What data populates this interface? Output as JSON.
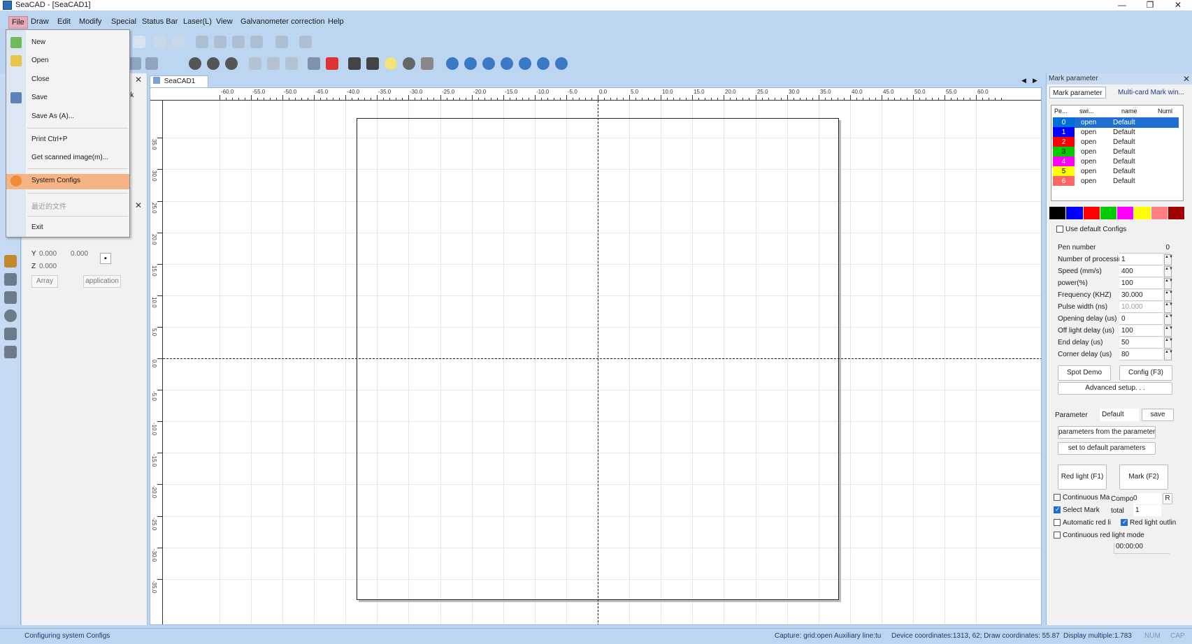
{
  "window": {
    "title": "SeaCAD - [SeaCAD1]",
    "min_glyph": "—",
    "max_glyph": "❐",
    "close_glyph": "✕"
  },
  "menubar": {
    "items": [
      "File",
      "Draw",
      "Edit",
      "Modify",
      "Special",
      "Status Bar",
      "Laser(L)",
      "View",
      "Galvanometer correction",
      "Help"
    ]
  },
  "file_menu": {
    "items": [
      {
        "label": "New",
        "icon": "new-icon"
      },
      {
        "label": "Open",
        "icon": "open-folder-icon"
      },
      {
        "label": "Close",
        "icon": ""
      },
      {
        "label": "Save",
        "icon": "save-icon"
      },
      {
        "label": "Save As (A)...",
        "icon": ""
      },
      {
        "label": "Print Ctrl+P",
        "icon": ""
      },
      {
        "label": "Get scanned image(m)...",
        "icon": ""
      },
      {
        "label": "System Configs",
        "icon": "gear-icon"
      },
      {
        "label": "最近的文件",
        "icon": ""
      },
      {
        "label": "Exit",
        "icon": ""
      }
    ],
    "highlighted": "System Configs"
  },
  "left_panel": {
    "partial_label": "rk",
    "y_label": "Y",
    "y_value": "0.000",
    "y_value2": "0.000",
    "z_label": "Z",
    "z_value": "0.000",
    "array_btn": "Array",
    "apply_btn": "application"
  },
  "document": {
    "tab_label": "SeaCAD1",
    "tab_close": "✕"
  },
  "ruler": {
    "h_labels": [
      "-60.0",
      "-55.0",
      "-50.0",
      "-45.0",
      "-40.0",
      "-35.0",
      "-30.0",
      "-25.0",
      "-20.0",
      "-15.0",
      "-10.0",
      "-5.0",
      "0.0",
      "5.0",
      "10.0",
      "15.0",
      "20.0",
      "25.0",
      "30.0",
      "35.0",
      "40.0",
      "45.0",
      "50.0",
      "55.0",
      "60.0"
    ],
    "v_labels": [
      "35.0",
      "30.0",
      "25.0",
      "20.0",
      "15.0",
      "10.0",
      "5.0",
      "0.0",
      "-5.0",
      "-10.0",
      "-15.0",
      "-20.0",
      "-25.0",
      "-30.0",
      "-35.0"
    ]
  },
  "right_panel": {
    "header": "Mark parameter",
    "tabs": [
      "Mark parameter",
      "Multi-card Mark win..."
    ],
    "pen_table": {
      "columns": [
        "Pe...",
        "swi...",
        "name",
        "Numl"
      ],
      "rows": [
        {
          "num": "0",
          "switch": "open",
          "name": "Default",
          "color": "#0070d8",
          "selected": true
        },
        {
          "num": "1",
          "switch": "open",
          "name": "Default",
          "color": "#0000ff",
          "selected": false
        },
        {
          "num": "2",
          "switch": "open",
          "name": "Default",
          "color": "#ff0000",
          "selected": false
        },
        {
          "num": "3",
          "switch": "open",
          "name": "Default",
          "color": "#00cc00",
          "selected": false
        },
        {
          "num": "4",
          "switch": "open",
          "name": "Default",
          "color": "#ff00ff",
          "selected": false
        },
        {
          "num": "5",
          "switch": "open",
          "name": "Default",
          "color": "#ffff00",
          "selected": false
        },
        {
          "num": "6",
          "switch": "open",
          "name": "Default",
          "color": "#ff6666",
          "selected": false
        }
      ]
    },
    "swatch_colors": [
      "#000000",
      "#0000ff",
      "#ff0000",
      "#00cc00",
      "#ff00ff",
      "#ffff00",
      "#ff8080",
      "#a00000"
    ],
    "use_default_configs": "Use default Configs",
    "params": [
      {
        "label": "Pen number",
        "value": "0",
        "spin": false,
        "disabled": false
      },
      {
        "label": "Number of processir",
        "value": "1",
        "spin": true,
        "disabled": false
      },
      {
        "label": "Speed (mm/s)",
        "value": "400",
        "spin": true,
        "disabled": false
      },
      {
        "label": "power(%)",
        "value": "100",
        "spin": true,
        "disabled": false
      },
      {
        "label": "Frequency (KHZ)",
        "value": "30.000",
        "spin": true,
        "disabled": false
      },
      {
        "label": "Pulse width (ns)",
        "value": "10.000",
        "spin": true,
        "disabled": true
      },
      {
        "label": "Opening delay (us)",
        "value": "0",
        "spin": true,
        "disabled": false
      },
      {
        "label": "Off light delay (us)",
        "value": "100",
        "spin": true,
        "disabled": false
      },
      {
        "label": "End delay (us)",
        "value": "50",
        "spin": true,
        "disabled": false
      },
      {
        "label": "Corner delay (us)",
        "value": "80",
        "spin": true,
        "disabled": false
      }
    ],
    "spot_demo": "Spot Demo",
    "config_f3": "Config (F3)",
    "advanced": "Advanced setup. . .",
    "parameter_label": "Parameter",
    "parameter_value": "Default",
    "save": "save",
    "from_params": "parameters from the parameter",
    "set_default": "set to default parameters",
    "red_light": "Red light (F1)",
    "mark": "Mark (F2)",
    "continuous_mark": "Continuous Ma",
    "compo_label": "Compo",
    "compo_value": "0",
    "r_btn": "R",
    "select_mark": "Select Mark",
    "total_label": "total",
    "total_value": "1",
    "auto_red": "Automatic red lig",
    "red_outline": "Red light outlin",
    "continuous_red": "Continuous red light mode",
    "timer": "00:00:00"
  },
  "statusbar": {
    "message": "Configuring system Configs",
    "capture": "Capture: grid:open Auxiliary line:tu",
    "device": "Device coordinates:1313, 62; Draw coordinates: 55.87",
    "display": "Display multiple:1.783",
    "num": "NUM",
    "cap": "CAP"
  },
  "colors": {
    "chrome": "#bcd6f2",
    "highlight": "#f6b386",
    "file_active": "#e7a9b5"
  }
}
